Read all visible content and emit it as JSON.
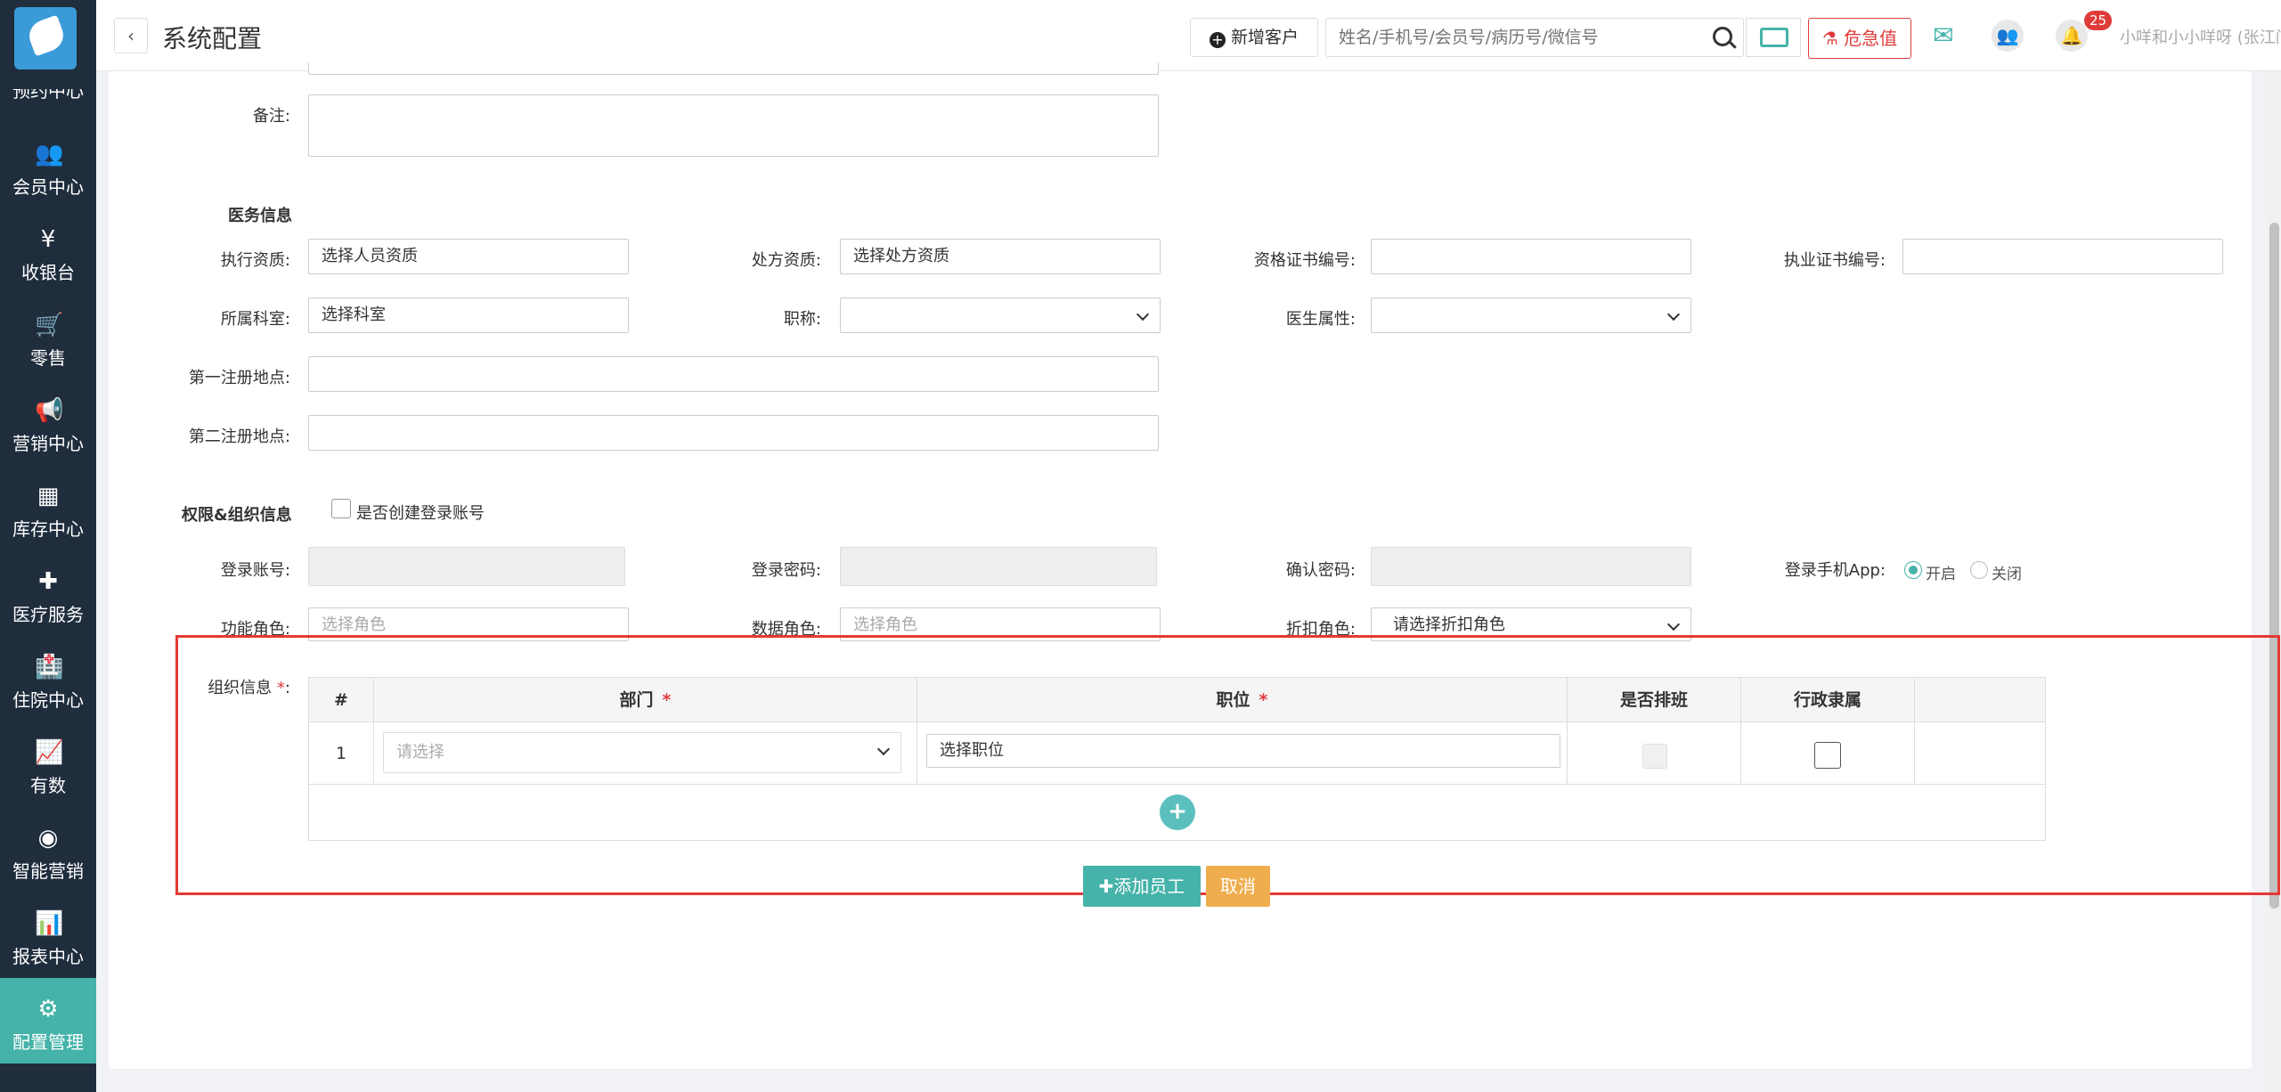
{
  "sidebar": {
    "partial_label": "预约中心",
    "items": [
      {
        "icon": "users-icon",
        "glyph": "👥",
        "label": "会员中心"
      },
      {
        "icon": "yen-icon",
        "glyph": "¥",
        "label": "收银台"
      },
      {
        "icon": "cart-icon",
        "glyph": "🛒",
        "label": "零售"
      },
      {
        "icon": "megaphone-icon",
        "glyph": "📢",
        "label": "营销中心"
      },
      {
        "icon": "grid-icon",
        "glyph": "▦",
        "label": "库存中心"
      },
      {
        "icon": "medkit-icon",
        "glyph": "✚",
        "label": "医疗服务"
      },
      {
        "icon": "hospital-icon",
        "glyph": "🏥",
        "label": "住院中心"
      },
      {
        "icon": "trend-icon",
        "glyph": "📈",
        "label": "有数"
      },
      {
        "icon": "smart-marketing-icon",
        "glyph": "◉",
        "label": "智能营销"
      },
      {
        "icon": "bar-chart-icon",
        "glyph": "📊",
        "label": "报表中心"
      },
      {
        "icon": "gear-icon",
        "glyph": "⚙",
        "label": "配置管理"
      }
    ]
  },
  "header": {
    "back": "‹",
    "title": "系统配置",
    "new_customer": "新增客户",
    "search_placeholder": "姓名/手机号/会员号/病历号/微信号",
    "critical_value": "危急值",
    "badge_count": "25",
    "user": "小咩和小小咩呀 (张江门诊部) ⌄"
  },
  "form": {
    "remark_label": "备注:",
    "medical_section": "医务信息",
    "exec_qual_label": "执行资质:",
    "exec_qual_value": "选择人员资质",
    "rx_qual_label": "处方资质:",
    "rx_qual_value": "选择处方资质",
    "cert_no_label": "资格证书编号:",
    "license_no_label": "执业证书编号:",
    "dept_label": "所属科室:",
    "dept_value": "选择科室",
    "title_label": "职称:",
    "doctor_attr_label": "医生属性:",
    "first_reg_label": "第一注册地点:",
    "second_reg_label": "第二注册地点:",
    "perm_section": "权限&组织信息",
    "create_account": "是否创建登录账号",
    "login_account_label": "登录账号:",
    "login_pwd_label": "登录密码:",
    "confirm_pwd_label": "确认密码:",
    "mobile_app_label": "登录手机App:",
    "app_on": "开启",
    "app_off": "关闭",
    "func_role_label": "功能角色:",
    "func_role_ph": "选择角色",
    "data_role_label": "数据角色:",
    "data_role_ph": "选择角色",
    "discount_role_label": "折扣角色:",
    "discount_role_value": "请选择折扣角色",
    "org_label": "组织信息",
    "org_req": "*",
    "org_colon": ":"
  },
  "org_table": {
    "headers": {
      "index": "#",
      "dept": "部门",
      "position": "职位",
      "shift": "是否排班",
      "admin": "行政隶属"
    },
    "req_mark": "*",
    "rows": [
      {
        "index": "1",
        "dept_ph": "请选择",
        "position_value": "选择职位"
      }
    ],
    "add_row": "+"
  },
  "actions": {
    "add_staff": "添加员工",
    "cancel": "取消"
  },
  "colors": {
    "sidebar_bg": "#1f2d3d",
    "accent": "#45b3a9",
    "danger": "#e03b3b",
    "warning": "#f0ad4e"
  }
}
